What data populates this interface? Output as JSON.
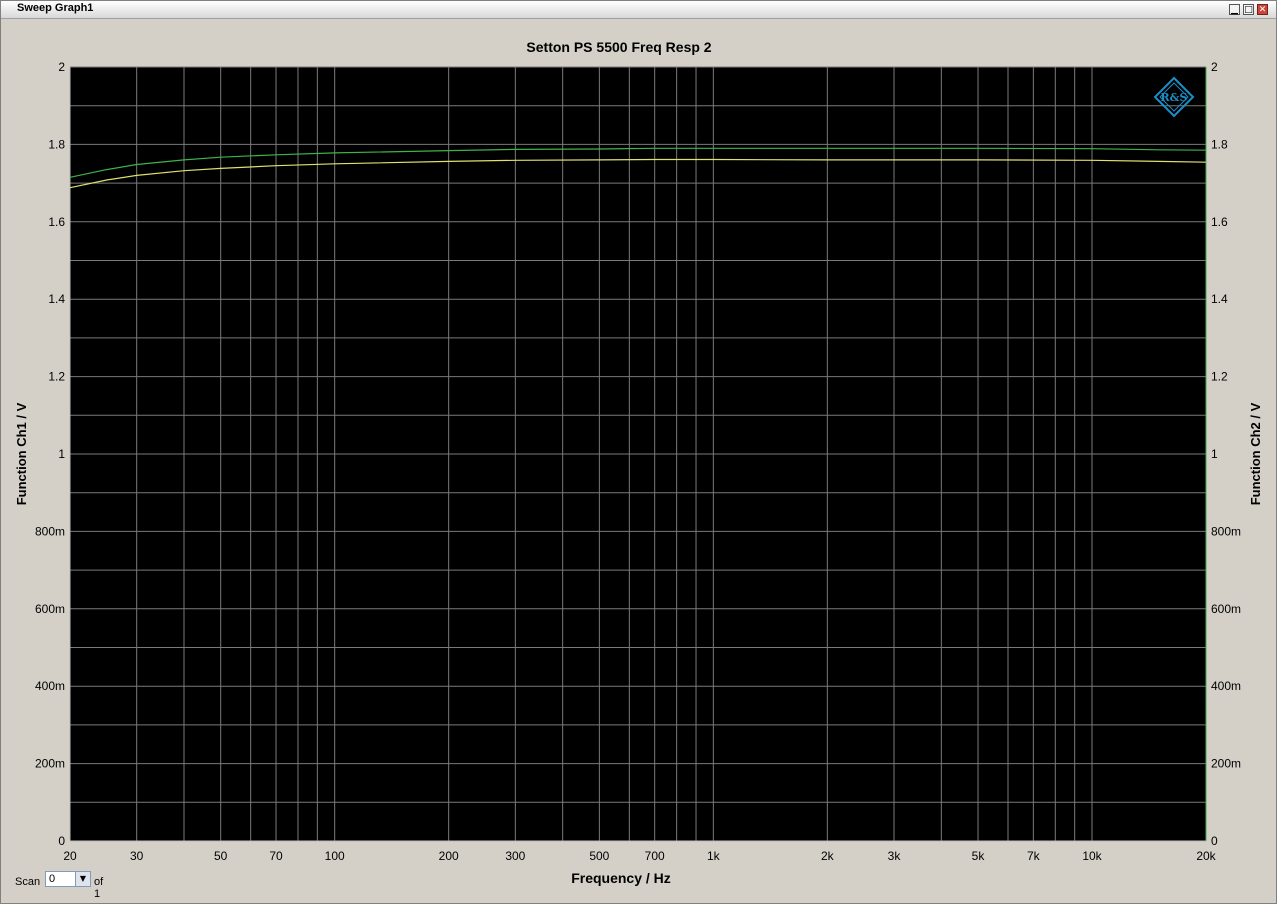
{
  "window": {
    "title": "Sweep Graph1"
  },
  "titlebar_buttons": {
    "minimize": "▁",
    "maximize": "□",
    "close": "✕"
  },
  "scan": {
    "label": "Scan",
    "value": "0",
    "of_label": "of 1",
    "arrow": "▼"
  },
  "colors": {
    "plot_bg": "#000000",
    "grid": "#7a7a7a",
    "ch1": "#3cb44b",
    "ch2": "#e0e070",
    "logo": "#1a8fc8"
  },
  "logo": {
    "name": "rohde-schwarz-logo",
    "text": "R&S"
  },
  "chart_data": {
    "type": "line",
    "title": "Setton PS 5500 Freq Resp 2",
    "xlabel": "Frequency / Hz",
    "ylabel_left": "Function Ch1 / V",
    "ylabel_right": "Function Ch2 / V",
    "x_scale": "log",
    "xlim": [
      20,
      20000
    ],
    "ylim": [
      0,
      2
    ],
    "grid": true,
    "x_ticks": [
      {
        "value": 20,
        "label": "20"
      },
      {
        "value": 30,
        "label": "30"
      },
      {
        "value": 50,
        "label": "50"
      },
      {
        "value": 70,
        "label": "70"
      },
      {
        "value": 100,
        "label": "100"
      },
      {
        "value": 200,
        "label": "200"
      },
      {
        "value": 300,
        "label": "300"
      },
      {
        "value": 500,
        "label": "500"
      },
      {
        "value": 700,
        "label": "700"
      },
      {
        "value": 1000,
        "label": "1k"
      },
      {
        "value": 2000,
        "label": "2k"
      },
      {
        "value": 3000,
        "label": "3k"
      },
      {
        "value": 5000,
        "label": "5k"
      },
      {
        "value": 7000,
        "label": "7k"
      },
      {
        "value": 10000,
        "label": "10k"
      },
      {
        "value": 20000,
        "label": "20k"
      }
    ],
    "y_ticks": [
      {
        "value": 0,
        "label": "0"
      },
      {
        "value": 0.2,
        "label": "200m"
      },
      {
        "value": 0.4,
        "label": "400m"
      },
      {
        "value": 0.6,
        "label": "600m"
      },
      {
        "value": 0.8,
        "label": "800m"
      },
      {
        "value": 1.0,
        "label": "1"
      },
      {
        "value": 1.2,
        "label": "1.2"
      },
      {
        "value": 1.4,
        "label": "1.4"
      },
      {
        "value": 1.6,
        "label": "1.6"
      },
      {
        "value": 1.8,
        "label": "1.8"
      },
      {
        "value": 2.0,
        "label": "2"
      }
    ],
    "series": [
      {
        "color": "#3cb44b",
        "x": [
          20,
          25,
          30,
          40,
          50,
          70,
          100,
          200,
          300,
          500,
          700,
          1000,
          2000,
          5000,
          10000,
          15000,
          20000
        ],
        "y": [
          1.715,
          1.735,
          1.748,
          1.76,
          1.767,
          1.773,
          1.778,
          1.784,
          1.787,
          1.788,
          1.79,
          1.79,
          1.79,
          1.79,
          1.789,
          1.786,
          1.785
        ]
      },
      {
        "color": "#e0e070",
        "x": [
          20,
          25,
          30,
          40,
          50,
          70,
          100,
          200,
          300,
          500,
          700,
          1000,
          2000,
          5000,
          10000,
          15000,
          20000
        ],
        "y": [
          1.688,
          1.708,
          1.72,
          1.732,
          1.738,
          1.745,
          1.75,
          1.756,
          1.759,
          1.76,
          1.761,
          1.761,
          1.76,
          1.76,
          1.759,
          1.756,
          1.754
        ]
      }
    ]
  }
}
